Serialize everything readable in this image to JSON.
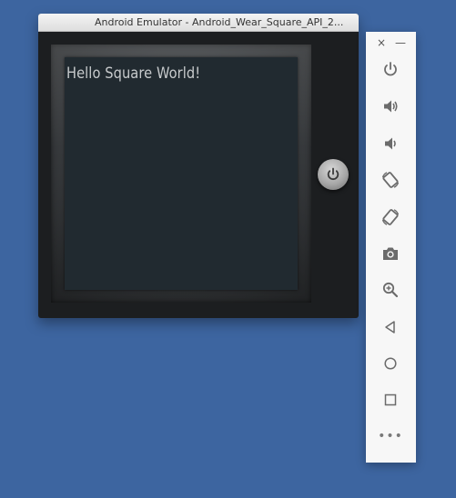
{
  "window": {
    "title": "Android Emulator - Android_Wear_Square_API_2..."
  },
  "screen": {
    "text": "Hello Square World!"
  },
  "toolbar": {
    "close_glyph": "×",
    "minimize_glyph": "—",
    "buttons": [
      {
        "name": "power",
        "icon": "power-icon"
      },
      {
        "name": "volume-up",
        "icon": "volume-up-icon"
      },
      {
        "name": "volume-down",
        "icon": "volume-down-icon"
      },
      {
        "name": "rotate-left",
        "icon": "rotate-left-icon"
      },
      {
        "name": "rotate-right",
        "icon": "rotate-right-icon"
      },
      {
        "name": "screenshot",
        "icon": "camera-icon"
      },
      {
        "name": "zoom",
        "icon": "zoom-icon"
      },
      {
        "name": "back",
        "icon": "back-triangle-icon"
      },
      {
        "name": "home",
        "icon": "home-circle-icon"
      },
      {
        "name": "overview",
        "icon": "overview-square-icon"
      },
      {
        "name": "more",
        "icon": "more-dots-icon"
      }
    ],
    "more_label": "•••"
  },
  "colors": {
    "desktop": "#3d65a0",
    "screen": "#212a30",
    "icon": "#6b6b6b"
  }
}
